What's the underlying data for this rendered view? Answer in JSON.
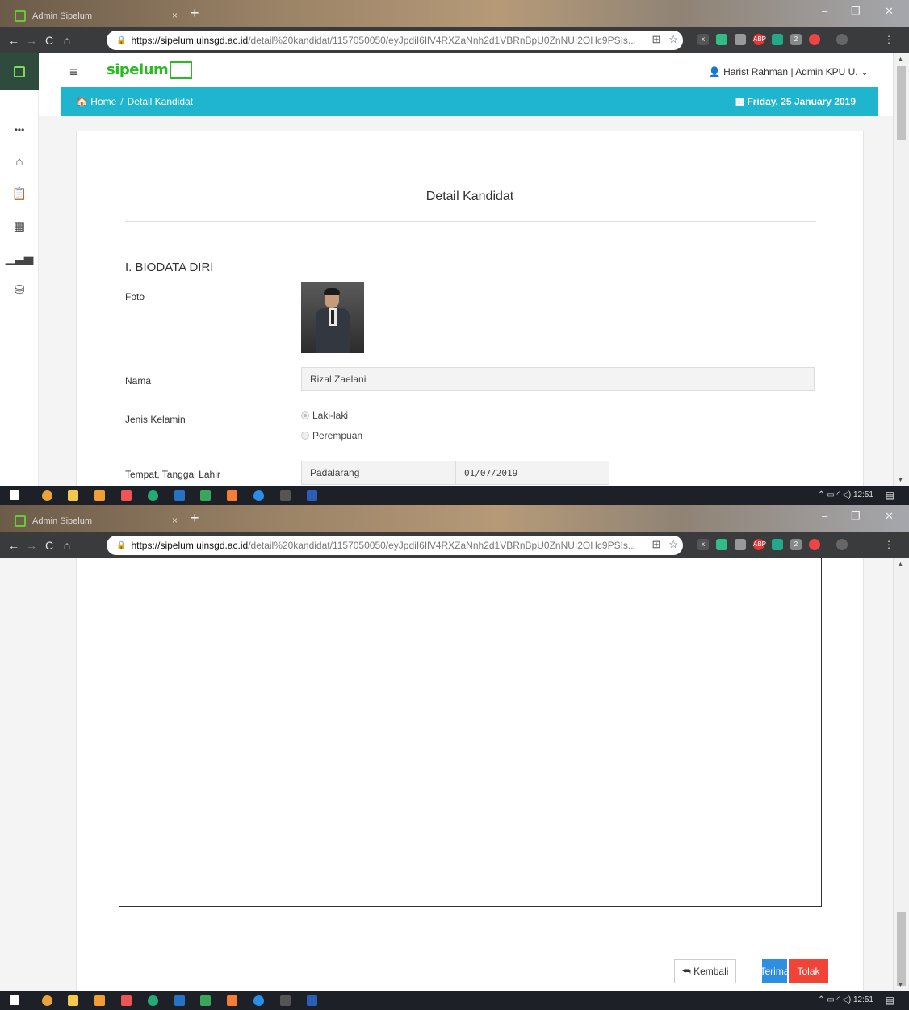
{
  "browser": {
    "tab_title": "Admin Sipelum",
    "tab_close": "×",
    "new_tab": "+",
    "url_host": "https://sipelum.uinsgd.ac.id",
    "url_path": "/detail%20kandidat/1157050050/eyJpdiI6IlV4RXZaNnh2d1VBRnBpU0ZnNUI2OHc9PSIs..."
  },
  "header": {
    "brand": "sipelum",
    "user": "Harist Rahman | Admin KPU U."
  },
  "breadcrumb": {
    "home": "Home",
    "separator": "/",
    "current": "Detail Kandidat",
    "date": "Friday, 25 January 2019"
  },
  "card": {
    "title": "Detail Kandidat",
    "section_title": "I. BIODATA DIRI",
    "foto_label": "Foto",
    "nama_label": "Nama",
    "nama_value": "Rizal Zaelani",
    "gender_label": "Jenis Kelamin",
    "gender_options": [
      "Laki-laki",
      "Perempuan"
    ],
    "gender_selected": "Laki-laki",
    "ttl_label": "Tempat, Tanggal Lahir",
    "tempat_value": "Padalarang",
    "tanggal_value": "01/07/2019"
  },
  "sidebar": {
    "items": [
      "more-icon",
      "home-icon",
      "clipboard-icon",
      "calendar-icon",
      "chart-icon",
      "database-icon"
    ]
  },
  "actions": {
    "back_label": "Kembali",
    "accept_label": "Terima",
    "reject_label": "Tolak"
  },
  "taskbar": {
    "time": "12:51"
  },
  "colors": {
    "brand_green": "#2cba24",
    "breadcrumb_bg": "#1fb5cf",
    "accept_blue": "#2e8ee0",
    "reject_red": "#f14436",
    "sidebar_dark": "#2f4b3d"
  }
}
